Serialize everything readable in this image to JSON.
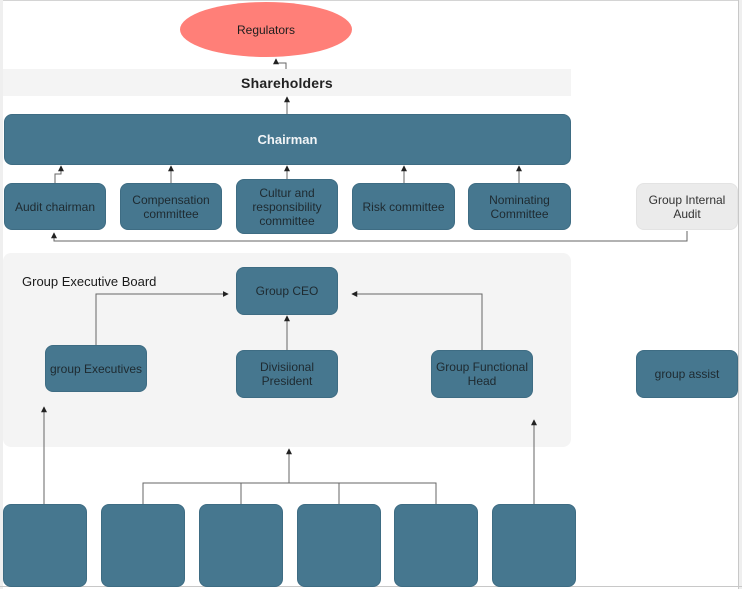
{
  "diagram": {
    "regulators": "Regulators",
    "shareholders": "Shareholders",
    "chairman": "Chairman",
    "committees": [
      {
        "id": "audit-chairman",
        "label": "Audit chairman"
      },
      {
        "id": "compensation-committee",
        "label": "Compensation committee"
      },
      {
        "id": "culture-committee",
        "label": "Cultur and responsibility committee"
      },
      {
        "id": "risk-committee",
        "label": "Risk committee"
      },
      {
        "id": "nominating-committee",
        "label": "Nominating Committee"
      }
    ],
    "group_internal_audit": "Group Internal Audit",
    "group_executive_board": {
      "title": "Group Executive Board",
      "ceo": "Group CEO",
      "executives": "group Executives",
      "divisional_president": "Divisiional President",
      "functional_head": "Group Functional Head"
    },
    "group_assist": "group assist",
    "bottom_units": [
      "",
      "",
      "",
      "",
      "",
      ""
    ]
  },
  "colors": {
    "node": "#46778f",
    "regulators": "#ff7f78",
    "panel": "#f4f4f4",
    "audit_node": "#ebebeb"
  }
}
